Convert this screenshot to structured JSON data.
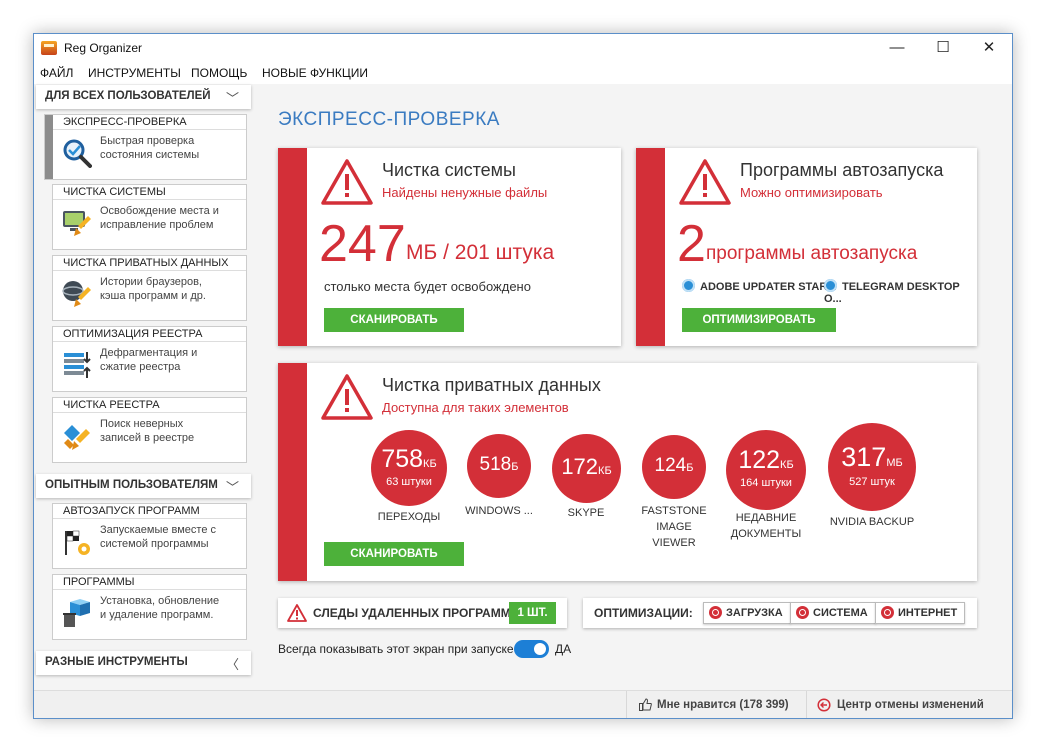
{
  "window": {
    "title": "Reg Organizer",
    "minimize": "—",
    "maximize": "☐",
    "close": "✕"
  },
  "menu": [
    "ФАЙЛ",
    "ИНСТРУМЕНТЫ",
    "ПОМОЩЬ",
    "НОВЫЕ ФУНКЦИИ"
  ],
  "sidebar": {
    "sections": [
      {
        "title": "ДЛЯ ВСЕХ ПОЛЬЗОВАТЕЛЕЙ",
        "chevron": "﹀"
      },
      {
        "title": "ОПЫТНЫМ ПОЛЬЗОВАТЕЛЯМ",
        "chevron": "﹀"
      },
      {
        "title": "РАЗНЫЕ ИНСТРУМЕНТЫ",
        "chevron": "〈"
      }
    ],
    "items": [
      {
        "label": "ЭКСПРЕСС-ПРОВЕРКА",
        "desc1": "Быстрая проверка",
        "desc2": "состояния системы",
        "icon": "magnifier-check-icon"
      },
      {
        "label": "ЧИСТКА СИСТЕМЫ",
        "desc1": "Освобождение места и",
        "desc2": "исправление проблем",
        "icon": "computer-broom-icon"
      },
      {
        "label": "ЧИСТКА ПРИВАТНЫХ ДАННЫХ",
        "desc1": "Истории браузеров,",
        "desc2": "кэша программ и др.",
        "icon": "privacy-broom-icon"
      },
      {
        "label": "ОПТИМИЗАЦИЯ РЕЕСТРА",
        "desc1": "Дефрагментация и",
        "desc2": "сжатие реестра",
        "icon": "registry-compress-icon"
      },
      {
        "label": "ЧИСТКА РЕЕСТРА",
        "desc1": "Поиск неверных",
        "desc2": "записей в реестре",
        "icon": "registry-broom-icon"
      },
      {
        "label": "АВТОЗАПУСК ПРОГРАММ",
        "desc1": "Запускаемые вместе с",
        "desc2": "системой программы",
        "icon": "startup-flag-icon"
      },
      {
        "label": "ПРОГРАММЫ",
        "desc1": "Установка, обновление",
        "desc2": "и удаление программ.",
        "icon": "box-trash-icon"
      }
    ]
  },
  "main": {
    "page_title": "ЭКСПРЕСС-ПРОВЕРКА",
    "system_card": {
      "title": "Чистка системы",
      "subtitle": "Найдены ненужные файлы",
      "number": "247",
      "unit": "МБ / 201 штука",
      "note": "столько места будет освобождено",
      "button": "СКАНИРОВАТЬ"
    },
    "startup_card": {
      "title": "Программы автозапуска",
      "subtitle": "Можно оптимизировать",
      "number": "2",
      "unit": "программы автозапуска",
      "apps": [
        "ADOBE UPDATER STAR...",
        "TELEGRAM DESKTOP O..."
      ],
      "button": "ОПТИМИЗИРОВАТЬ"
    },
    "private_card": {
      "title": "Чистка приватных данных",
      "subtitle": "Доступна для таких элементов",
      "button": "СКАНИРОВАТЬ",
      "items": [
        {
          "value": "758",
          "unit": "КБ",
          "count": "63 штуки",
          "label1": "ПЕРЕХОДЫ",
          "label2": "",
          "label3": ""
        },
        {
          "value": "518",
          "unit": "Б",
          "count": "",
          "label1": "WINDOWS ...",
          "label2": "",
          "label3": ""
        },
        {
          "value": "172",
          "unit": "КБ",
          "count": "",
          "label1": "SKYPE",
          "label2": "",
          "label3": ""
        },
        {
          "value": "124",
          "unit": "Б",
          "count": "",
          "label1": "FASTSTONE",
          "label2": "IMAGE",
          "label3": "VIEWER"
        },
        {
          "value": "122",
          "unit": "КБ",
          "count": "164 штуки",
          "label1": "НЕДАВНИЕ",
          "label2": "ДОКУМЕНТЫ",
          "label3": ""
        },
        {
          "value": "317",
          "unit": "МБ",
          "count": "527 штук",
          "label1": "NVIDIA BACKUP",
          "label2": "",
          "label3": ""
        }
      ]
    },
    "traces": {
      "label": "СЛЕДЫ УДАЛЕННЫХ ПРОГРАММ",
      "badge": "1 ШТ."
    },
    "optimizations": {
      "label": "ОПТИМИЗАЦИИ:",
      "buttons": [
        "ЗАГРУЗКА",
        "СИСТЕМА",
        "ИНТЕРНЕТ"
      ]
    },
    "always_show": {
      "label": "Всегда показывать этот экран при запуске",
      "value": "ДА"
    }
  },
  "status": {
    "like": "Мне нравится (178 399)",
    "undo": "Центр отмены изменений"
  },
  "colors": {
    "accent_red": "#d32f38",
    "accent_green": "#4db13a",
    "title_blue": "#3a7bc1",
    "toggle_blue": "#1d7fd6"
  }
}
